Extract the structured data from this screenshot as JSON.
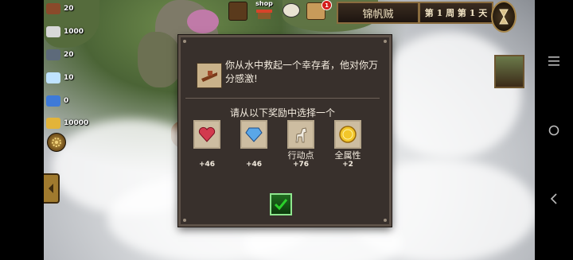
{
  "resources": [
    {
      "name": "wood",
      "value": "20",
      "color": "#8a4a2a"
    },
    {
      "name": "silver",
      "value": "1000",
      "color": "#d8d8d8"
    },
    {
      "name": "ore",
      "value": "20",
      "color": "#5d6a7a"
    },
    {
      "name": "diamond",
      "value": "10",
      "color": "#bfe3ff"
    },
    {
      "name": "crystal",
      "value": "0",
      "color": "#3e7ad8"
    },
    {
      "name": "gold",
      "value": "10000",
      "color": "#e2b43a"
    }
  ],
  "topbar": {
    "shop_label": "shop",
    "alert_count": "1",
    "player_name": "锦帆贼",
    "day_text": "第 1 周 第 1 天"
  },
  "dialog": {
    "message": "你从水中救起一个幸存者，他对你万分感激!",
    "prompt": "请从以下奖励中选择一个",
    "rewards": [
      {
        "icon": "ruby-heart-icon",
        "label": "",
        "value": "+46",
        "color": "#d23a4e"
      },
      {
        "icon": "blue-gem-icon",
        "label": "",
        "value": "+46",
        "color": "#5aa7e8"
      },
      {
        "icon": "white-horse-icon",
        "label": "行动点",
        "value": "+76",
        "color": "#efeadf"
      },
      {
        "icon": "gold-coin-icon",
        "label": "全属性",
        "value": "+2",
        "color": "#f2c62a"
      }
    ]
  },
  "colors": {
    "dialog_bg": "#38302c",
    "confirm_green": "#2bd02b"
  }
}
